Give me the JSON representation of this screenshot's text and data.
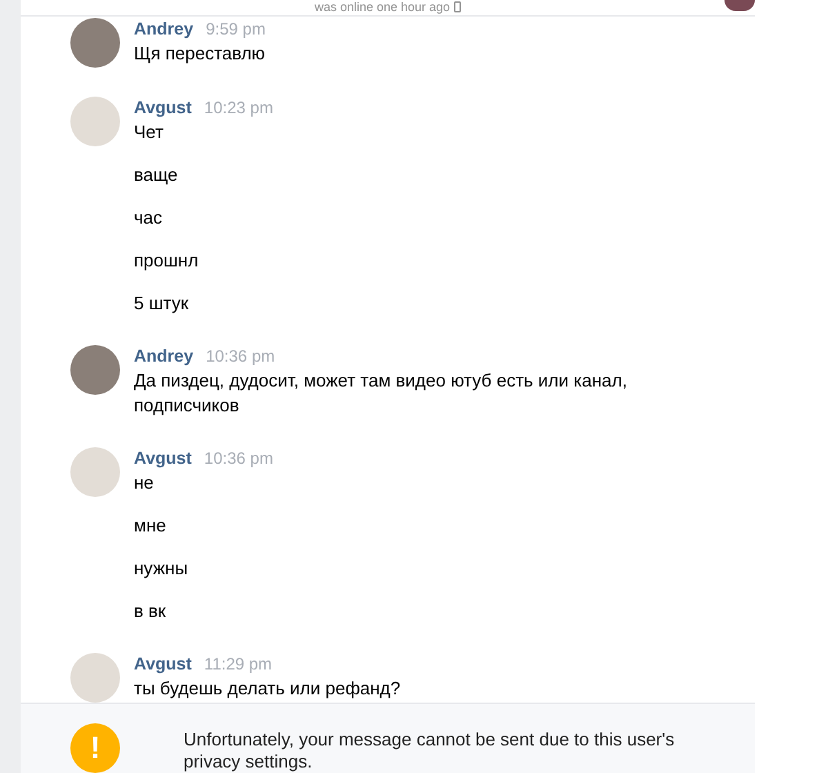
{
  "header": {
    "status": "was online one hour ago"
  },
  "messages": [
    {
      "author": "Andrey",
      "kind": "photo",
      "time": "9:59 pm",
      "lines": [
        "Щя переставлю"
      ]
    },
    {
      "author": "Avgust",
      "kind": "bird",
      "time": "10:23 pm",
      "lines": [
        "Чет",
        "ваще",
        "час",
        "прошнл",
        "5 штук"
      ]
    },
    {
      "author": "Andrey",
      "kind": "photo",
      "time": "10:36 pm",
      "lines": [
        "Да пиздец, дудосит, может там видео ютуб есть или канал, подписчиков"
      ]
    },
    {
      "author": "Avgust",
      "kind": "bird",
      "time": "10:36 pm",
      "lines": [
        "не",
        "мне",
        "нужны",
        "в вк"
      ]
    },
    {
      "author": "Avgust",
      "kind": "bird",
      "time": "11:29 pm",
      "lines": [
        "ты будешь делать или рефанд?"
      ]
    }
  ],
  "notice": {
    "icon": "!",
    "text": "Unfortunately, your message cannot be sent due to this user's privacy settings."
  }
}
